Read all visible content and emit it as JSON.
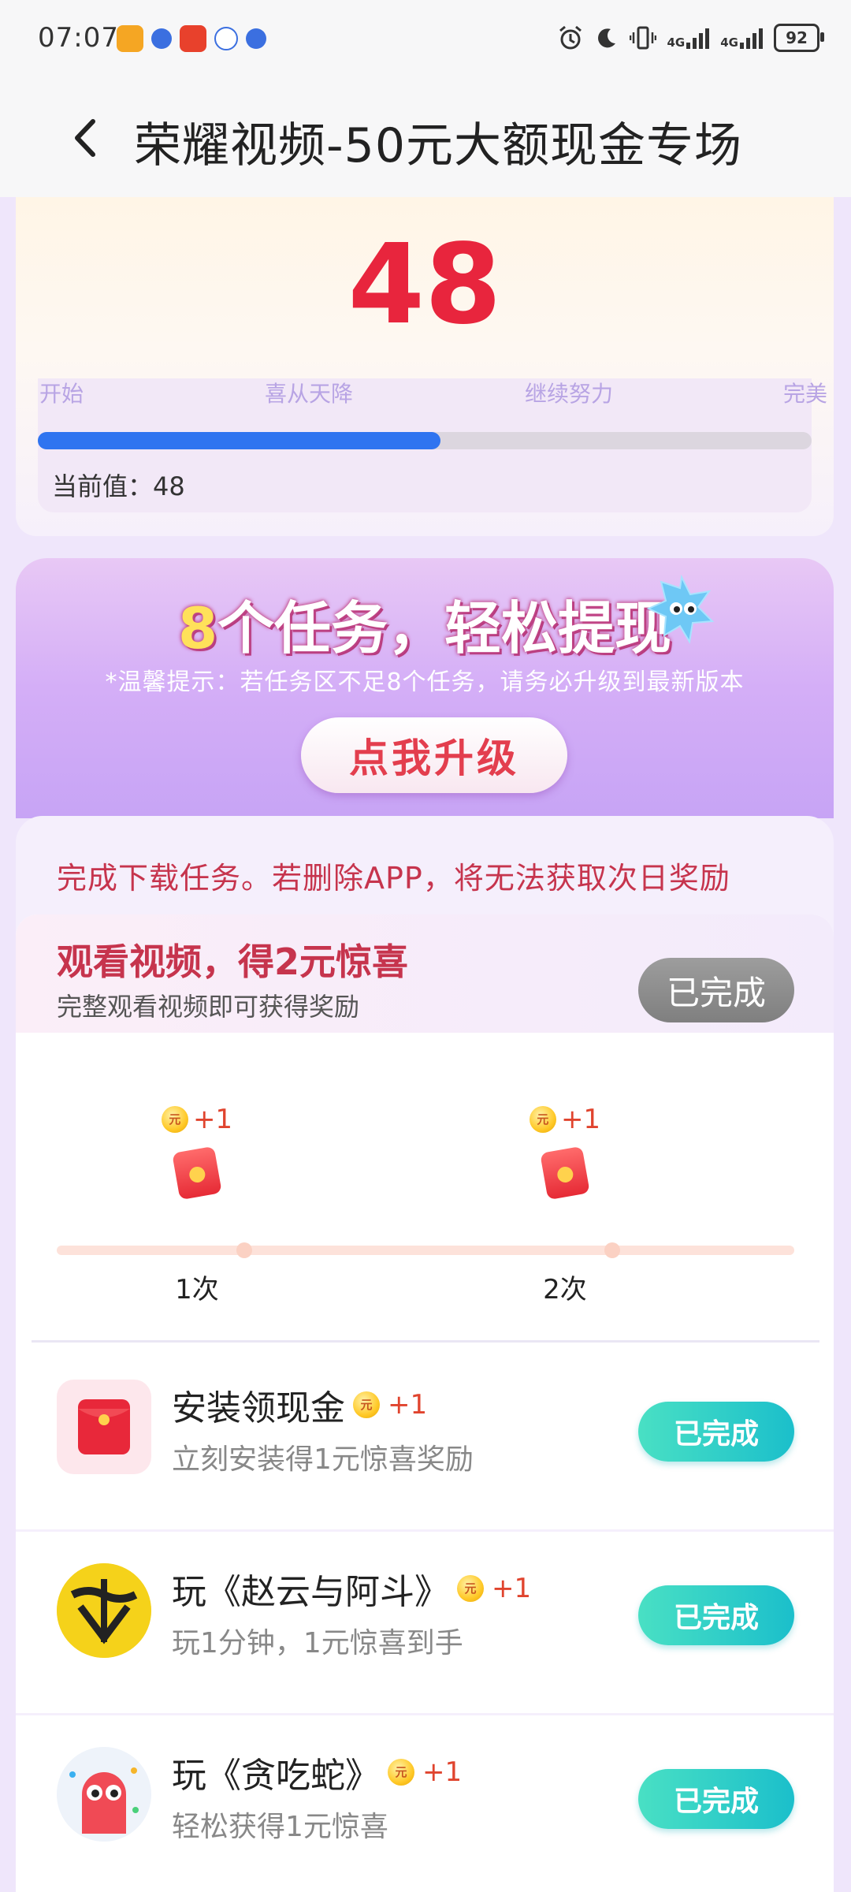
{
  "status_bar": {
    "time": "07:07",
    "network_1": "4G",
    "network_2": "4G",
    "battery": "92",
    "icons": [
      "alarm-icon",
      "moon-icon",
      "vibrate-icon",
      "signal-icon",
      "signal-icon",
      "battery-icon"
    ]
  },
  "header": {
    "back_icon": "chevron-left-icon",
    "title": "荣耀视频-50元大额现金专场"
  },
  "progress": {
    "value": "48",
    "milestones": [
      "开始",
      "喜从天降",
      "继续努力",
      "完美"
    ],
    "fraction": 0.52,
    "current_label": "当前值：48",
    "colors": {
      "value": "#e8253d",
      "bar": "#2f74f0",
      "track": "#dcd6df"
    }
  },
  "tasks_banner": {
    "title_num": "8",
    "title_text": "个任务，轻松提现",
    "notice": "*温馨提示：若任务区不足8个任务，请务必升级到最新版本",
    "upgrade_button": "点我升级"
  },
  "warning": "完成下载任务。若删除APP，将无法获取次日奖励",
  "video_task": {
    "title": "观看视频，得2元惊喜",
    "subtitle": "完整观看视频即可获得奖励",
    "status": "已完成",
    "steps": [
      {
        "reward": "+1",
        "label": "1次",
        "coin": "元"
      },
      {
        "reward": "+1",
        "label": "2次",
        "coin": "元"
      }
    ]
  },
  "task_list": [
    {
      "title": "安装领现金",
      "reward": "+1",
      "coin": "元",
      "subtitle": "立刻安装得1元惊喜奖励",
      "status": "已完成"
    },
    {
      "title": "玩《赵云与阿斗》",
      "reward": "+1",
      "coin": "元",
      "subtitle": "玩1分钟，1元惊喜到手",
      "status": "已完成"
    },
    {
      "title": "玩《贪吃蛇》",
      "reward": "+1",
      "coin": "元",
      "subtitle": "轻松获得1元惊喜",
      "status": "已完成"
    }
  ]
}
